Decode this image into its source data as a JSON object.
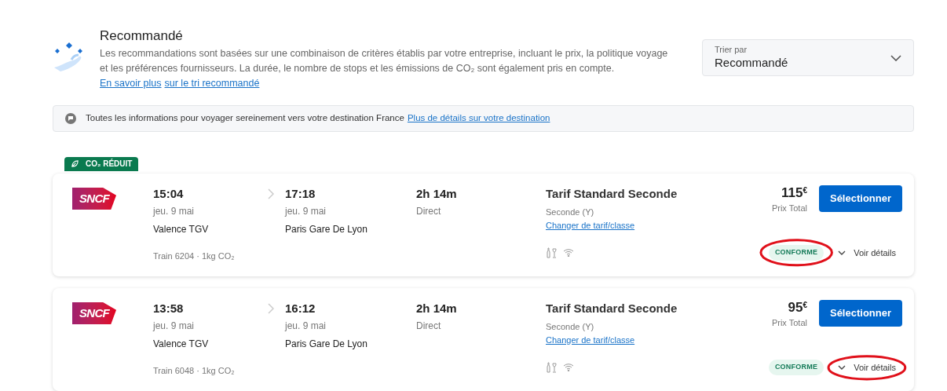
{
  "header": {
    "title": "Recommandé",
    "description": "Les recommandations sont basées sur une combinaison de critères établis par votre entreprise, incluant le prix, la politique voyage et les préférences fournisseurs. La durée, le nombre de stops et les émissions de CO₂ sont également pris en compte.",
    "link_lines": [
      "En savoir plus",
      "sur le tri recommandé"
    ]
  },
  "sort": {
    "label": "Trier par",
    "value": "Recommandé"
  },
  "info_bar": {
    "text": "Toutes les informations pour voyager sereinement vers votre destination France",
    "link": "Plus de détails sur votre destination"
  },
  "results": [
    {
      "tag": "CO₂ RÉDUIT",
      "carrier": "SNCF",
      "departure_time": "15:04",
      "departure_date": "jeu. 9 mai",
      "departure_station": "Valence TGV",
      "arrival_time": "17:18",
      "arrival_date": "jeu. 9 mai",
      "arrival_station": "Paris Gare De Lyon",
      "duration": "2h 14m",
      "stops": "Direct",
      "train": "Train 6204 · 1kg CO₂",
      "fare": "Tarif Standard Seconde",
      "fare_class": "Seconde (Y)",
      "change_link": "Changer de tarif/classe",
      "price": "115$^{€}$",
      "price_label": "Prix Total",
      "select": "Sélectionner",
      "policy": "CONFORME",
      "details": "Voir détails",
      "policy_circled": true,
      "details_circled": false
    },
    {
      "carrier": "SNCF",
      "departure_time": "13:58",
      "departure_date": "jeu. 9 mai",
      "departure_station": "Valence TGV",
      "arrival_time": "16:12",
      "arrival_date": "jeu. 9 mai",
      "arrival_station": "Paris Gare De Lyon",
      "duration": "2h 14m",
      "stops": "Direct",
      "train": "Train 6048 · 1kg CO₂",
      "fare": "Tarif Standard Seconde",
      "fare_class": "Seconde (Y)",
      "change_link": "Changer de tarif/classe",
      "price": "95$^{€}$",
      "price_label": "Prix Total",
      "select": "Sélectionner",
      "policy": "CONFORME",
      "details": "Voir détails",
      "policy_circled": false,
      "details_circled": true
    }
  ]
}
